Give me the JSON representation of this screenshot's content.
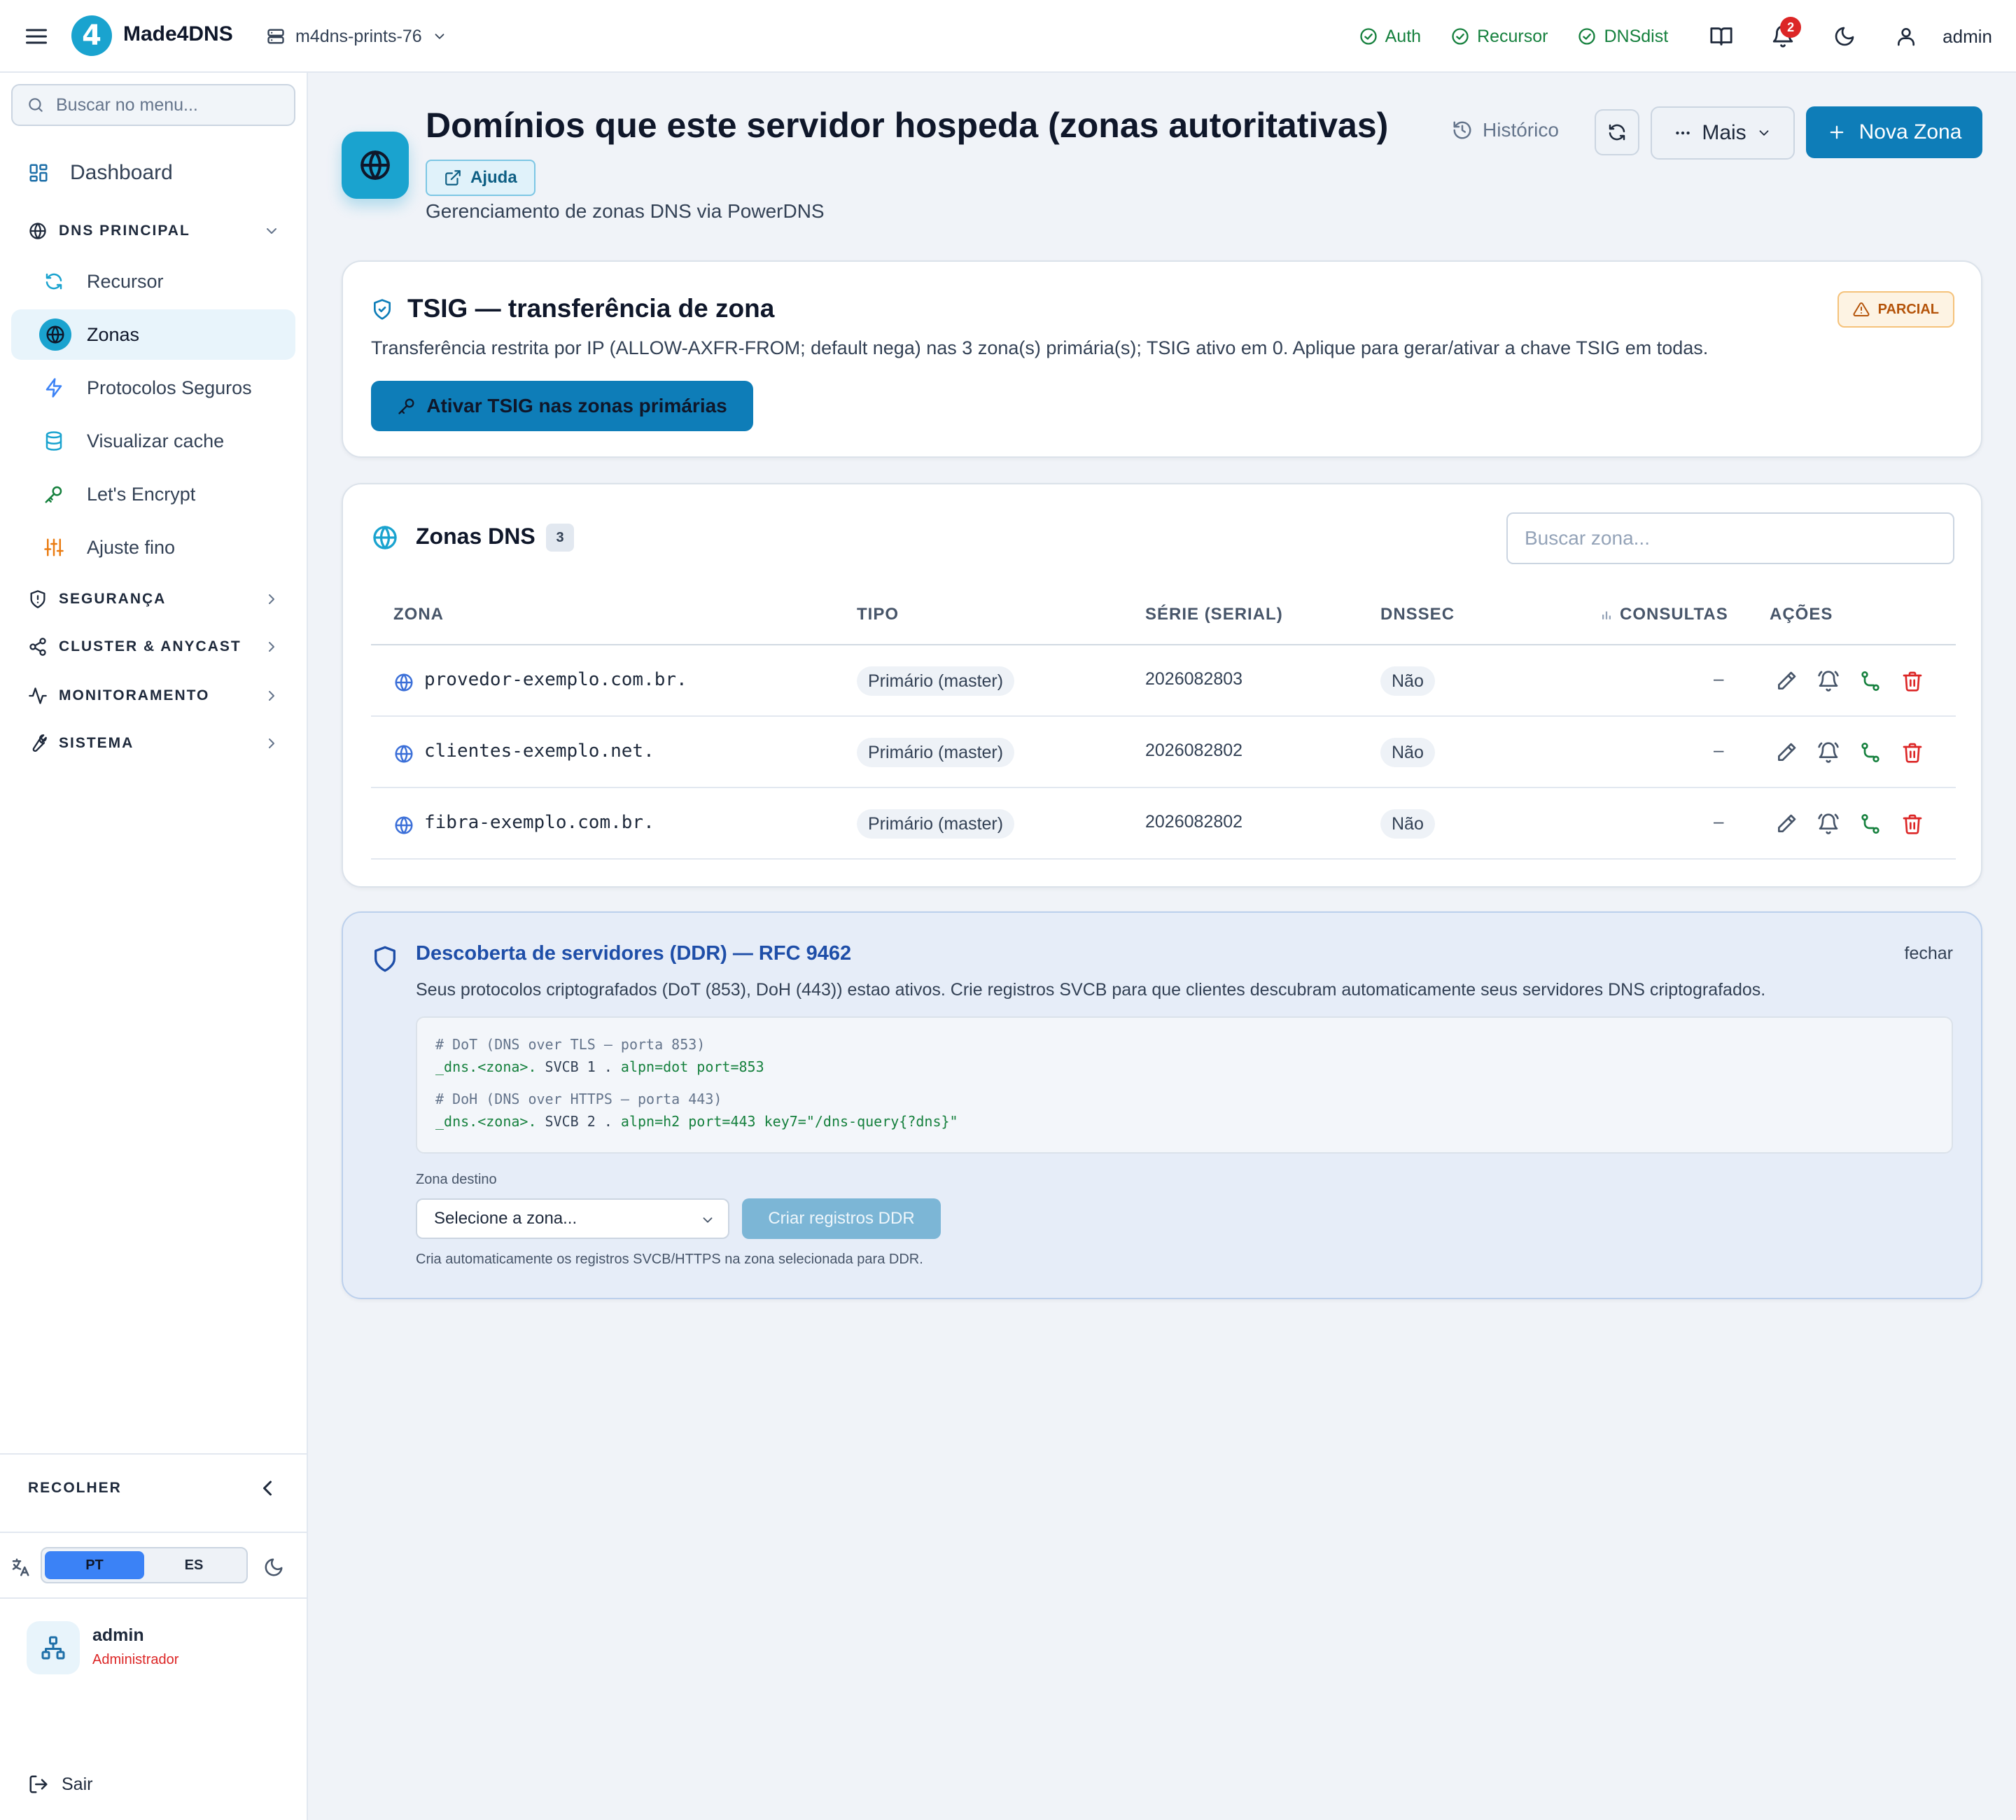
{
  "topbar": {
    "brand": "Made4DNS",
    "logo_glyph": "4",
    "server": "m4dns-prints-76",
    "services": [
      {
        "label": "Auth",
        "status": "ok"
      },
      {
        "label": "Recursor",
        "status": "ok"
      },
      {
        "label": "DNSdist",
        "status": "ok"
      }
    ],
    "notifications_count": "2",
    "user": "admin",
    "status_color": "#15803d"
  },
  "sidebar": {
    "search_placeholder": "Buscar no menu...",
    "dashboard": "Dashboard",
    "dns_section": "DNS PRINCIPAL",
    "dns_items": [
      {
        "label": "Recursor",
        "icon": "refresh-icon"
      },
      {
        "label": "Zonas",
        "icon": "globe-icon",
        "active": true
      },
      {
        "label": "Protocolos Seguros",
        "icon": "zap-icon"
      },
      {
        "label": "Visualizar cache",
        "icon": "database-icon"
      },
      {
        "label": "Let's Encrypt",
        "icon": "key-icon"
      },
      {
        "label": "Ajuste fino",
        "icon": "sliders-icon"
      }
    ],
    "sections": [
      {
        "label": "SEGURANÇA",
        "icon": "shield-icon"
      },
      {
        "label": "CLUSTER & ANYCAST",
        "icon": "share-icon"
      },
      {
        "label": "MONITORAMENTO",
        "icon": "activity-icon"
      },
      {
        "label": "SISTEMA",
        "icon": "wrench-icon"
      }
    ],
    "collapse_label": "RECOLHER",
    "lang_pt": "PT",
    "lang_es": "ES",
    "user_name": "admin",
    "user_role": "Administrador",
    "logout": "Sair"
  },
  "header": {
    "title": "Domínios que este servidor hospeda (zonas autoritativas)",
    "help": "Ajuda",
    "subtitle": "Gerenciamento de zonas DNS via PowerDNS",
    "history": "Histórico",
    "more": "Mais",
    "new_zone": "Nova Zona",
    "accent": "#0e7db8"
  },
  "tsig": {
    "title": "TSIG — transferência de zona",
    "badge": "PARCIAL",
    "description": "Transferência restrita por IP (ALLOW-AXFR-FROM; default nega) nas 3 zona(s) primária(s); TSIG ativo em 0. Aplique para gerar/ativar a chave TSIG em todas.",
    "button": "Ativar TSIG nas zonas primárias"
  },
  "zones": {
    "title": "Zonas DNS",
    "count": "3",
    "search_placeholder": "Buscar zona...",
    "columns": [
      "ZONA",
      "TIPO",
      "SÉRIE (SERIAL)",
      "DNSSEC",
      "CONSULTAS",
      "AÇÕES"
    ],
    "rows": [
      {
        "zone": "provedor-exemplo.com.br.",
        "type": "Primário (master)",
        "serial": "2026082803",
        "dnssec": "Não",
        "queries": "–"
      },
      {
        "zone": "clientes-exemplo.net.",
        "type": "Primário (master)",
        "serial": "2026082802",
        "dnssec": "Não",
        "queries": "–"
      },
      {
        "zone": "fibra-exemplo.com.br.",
        "type": "Primário (master)",
        "serial": "2026082802",
        "dnssec": "Não",
        "queries": "–"
      }
    ]
  },
  "ddr": {
    "title": "Descoberta de servidores (DDR) — RFC 9462",
    "close": "fechar",
    "description": "Seus protocolos criptografados (DoT (853), DoH (443)) estao ativos. Crie registros SVCB para que clientes descubram automaticamente seus servidores DNS criptografados.",
    "code": {
      "dot_comment": "# DoT (DNS over TLS — porta 853)",
      "dot_name": "_dns.<zona>.",
      "dot_mid": " SVCB 1 . ",
      "dot_params": "alpn=dot port=853",
      "doh_comment": "# DoH (DNS over HTTPS — porta 443)",
      "doh_name": "_dns.<zona>.",
      "doh_mid": " SVCB 2 . ",
      "doh_params": "alpn=h2 port=443 key7=\"/dns-query{?dns}\""
    },
    "zone_label": "Zona destino",
    "select_value": "Selecione a zona...",
    "create_button": "Criar registros DDR",
    "note": "Cria automaticamente os registros SVCB/HTTPS na zona selecionada para DDR."
  }
}
